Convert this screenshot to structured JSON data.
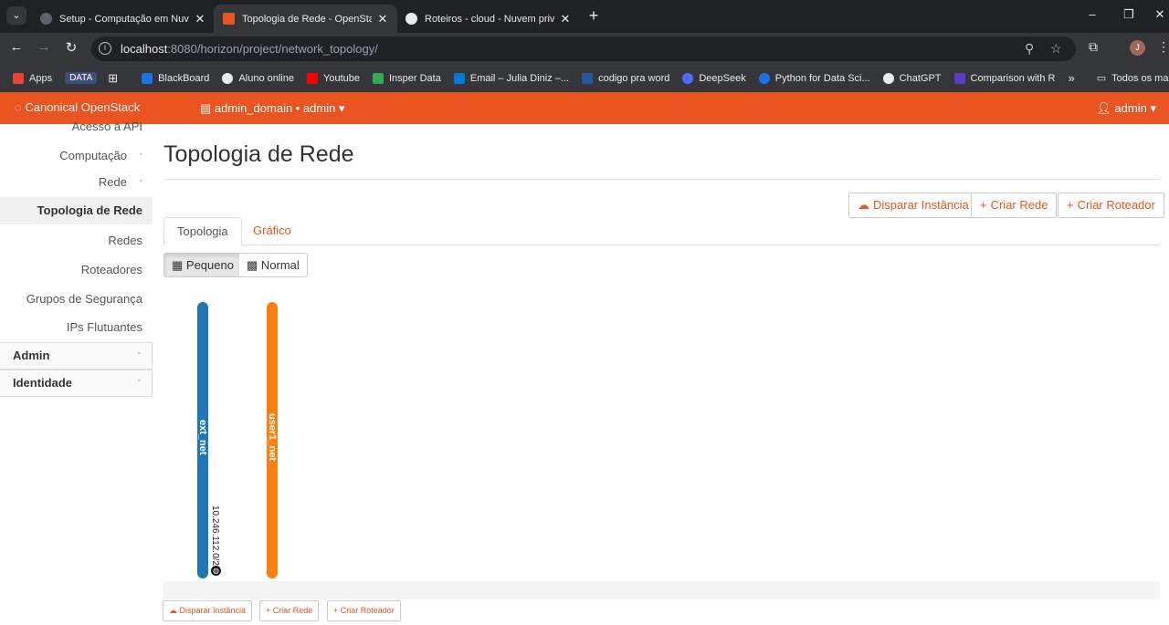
{
  "browser": {
    "tabs": [
      {
        "title": "Setup - Computação em Nuvem",
        "active": false,
        "favicon_color": "#ffffff"
      },
      {
        "title": "Topologia de Rede - OpenStack",
        "active": true,
        "favicon_color": "#e95420"
      },
      {
        "title": "Roteiros - cloud - Nuvem privada",
        "active": false,
        "favicon_color": "#ffffff"
      }
    ],
    "url_host": "localhost",
    "url_path": ":8080/horizon/project/network_topology/",
    "profile_initial": "J",
    "bookmarks": [
      {
        "label": "Apps",
        "color": "#ea4335"
      },
      {
        "label": "BlackBoard",
        "color": "#1a73e8"
      },
      {
        "label": "Aluno online",
        "color": "#ffffff"
      },
      {
        "label": "Youtube",
        "color": "#ff0000"
      },
      {
        "label": "Insper Data",
        "color": "#34a853"
      },
      {
        "label": "Email – Julia Diniz –...",
        "color": "#0078d4"
      },
      {
        "label": "codigo pra word",
        "color": "#2b579a"
      },
      {
        "label": "DeepSeek",
        "color": "#4d6bfe"
      },
      {
        "label": "Python for Data Sci...",
        "color": "#1a73e8"
      },
      {
        "label": "ChatGPT",
        "color": "#ffffff"
      },
      {
        "label": "Comparison with R",
        "color": "#5b3cc4"
      }
    ],
    "bookmark_data_chip": "DATA",
    "bookmarks_folder": "Todos os marcadores"
  },
  "header": {
    "brand": "Canonical OpenStack",
    "domain": "admin_domain • admin",
    "user": "admin"
  },
  "sidebar": {
    "top_partial": "Acesso à API",
    "computacao": "Computação",
    "rede": "Rede",
    "items": [
      "Topologia de Rede",
      "Redes",
      "Roteadores",
      "Grupos de Segurança",
      "IPs Flutuantes"
    ],
    "sections": [
      "Admin",
      "Identidade"
    ]
  },
  "main": {
    "title": "Topologia de Rede",
    "actions": {
      "launch": "Disparar Instância",
      "create_net": "Criar Rede",
      "create_router": "Criar Roteador"
    },
    "tabs": [
      "Topologia",
      "Gráfico"
    ],
    "toggles": [
      "Pequeno",
      "Normal"
    ],
    "networks": [
      {
        "name": "ext_net",
        "cidr": "10.246.112.0/21",
        "color": "#1f77b4"
      },
      {
        "name": "user1_net",
        "color": "#ff7f0e"
      }
    ]
  }
}
